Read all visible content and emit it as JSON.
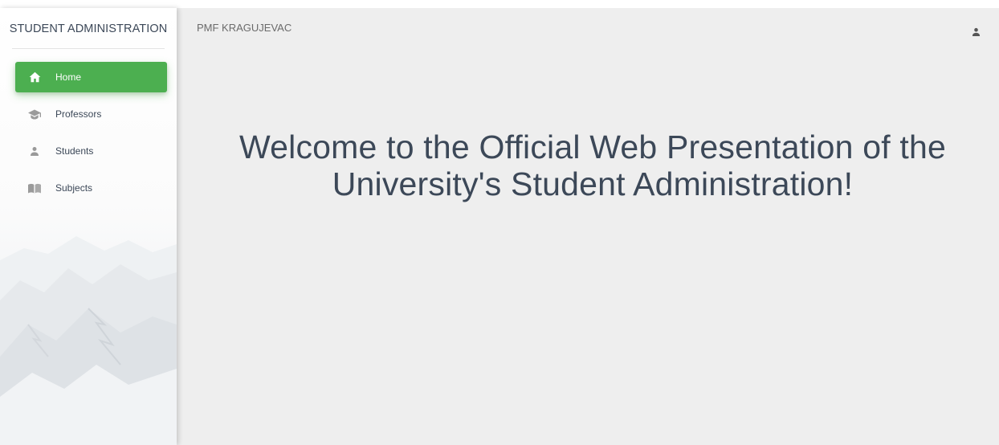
{
  "sidebar": {
    "brand": "STUDENT ADMINISTRATION",
    "items": [
      {
        "label": "Home",
        "icon": "home-icon",
        "active": true
      },
      {
        "label": "Professors",
        "icon": "graduation-cap-icon",
        "active": false
      },
      {
        "label": "Students",
        "icon": "person-icon",
        "active": false
      },
      {
        "label": "Subjects",
        "icon": "book-icon",
        "active": false
      }
    ]
  },
  "header": {
    "title": "PMF KRAGUJEVAC",
    "user_icon": "person-icon"
  },
  "main": {
    "welcome_line1": "Welcome to the Official Web Presentation of the",
    "welcome_line2": "University's Student Administration!"
  },
  "colors": {
    "accent": "#4caf50",
    "text": "#3c4858",
    "background": "#eeeeee"
  }
}
